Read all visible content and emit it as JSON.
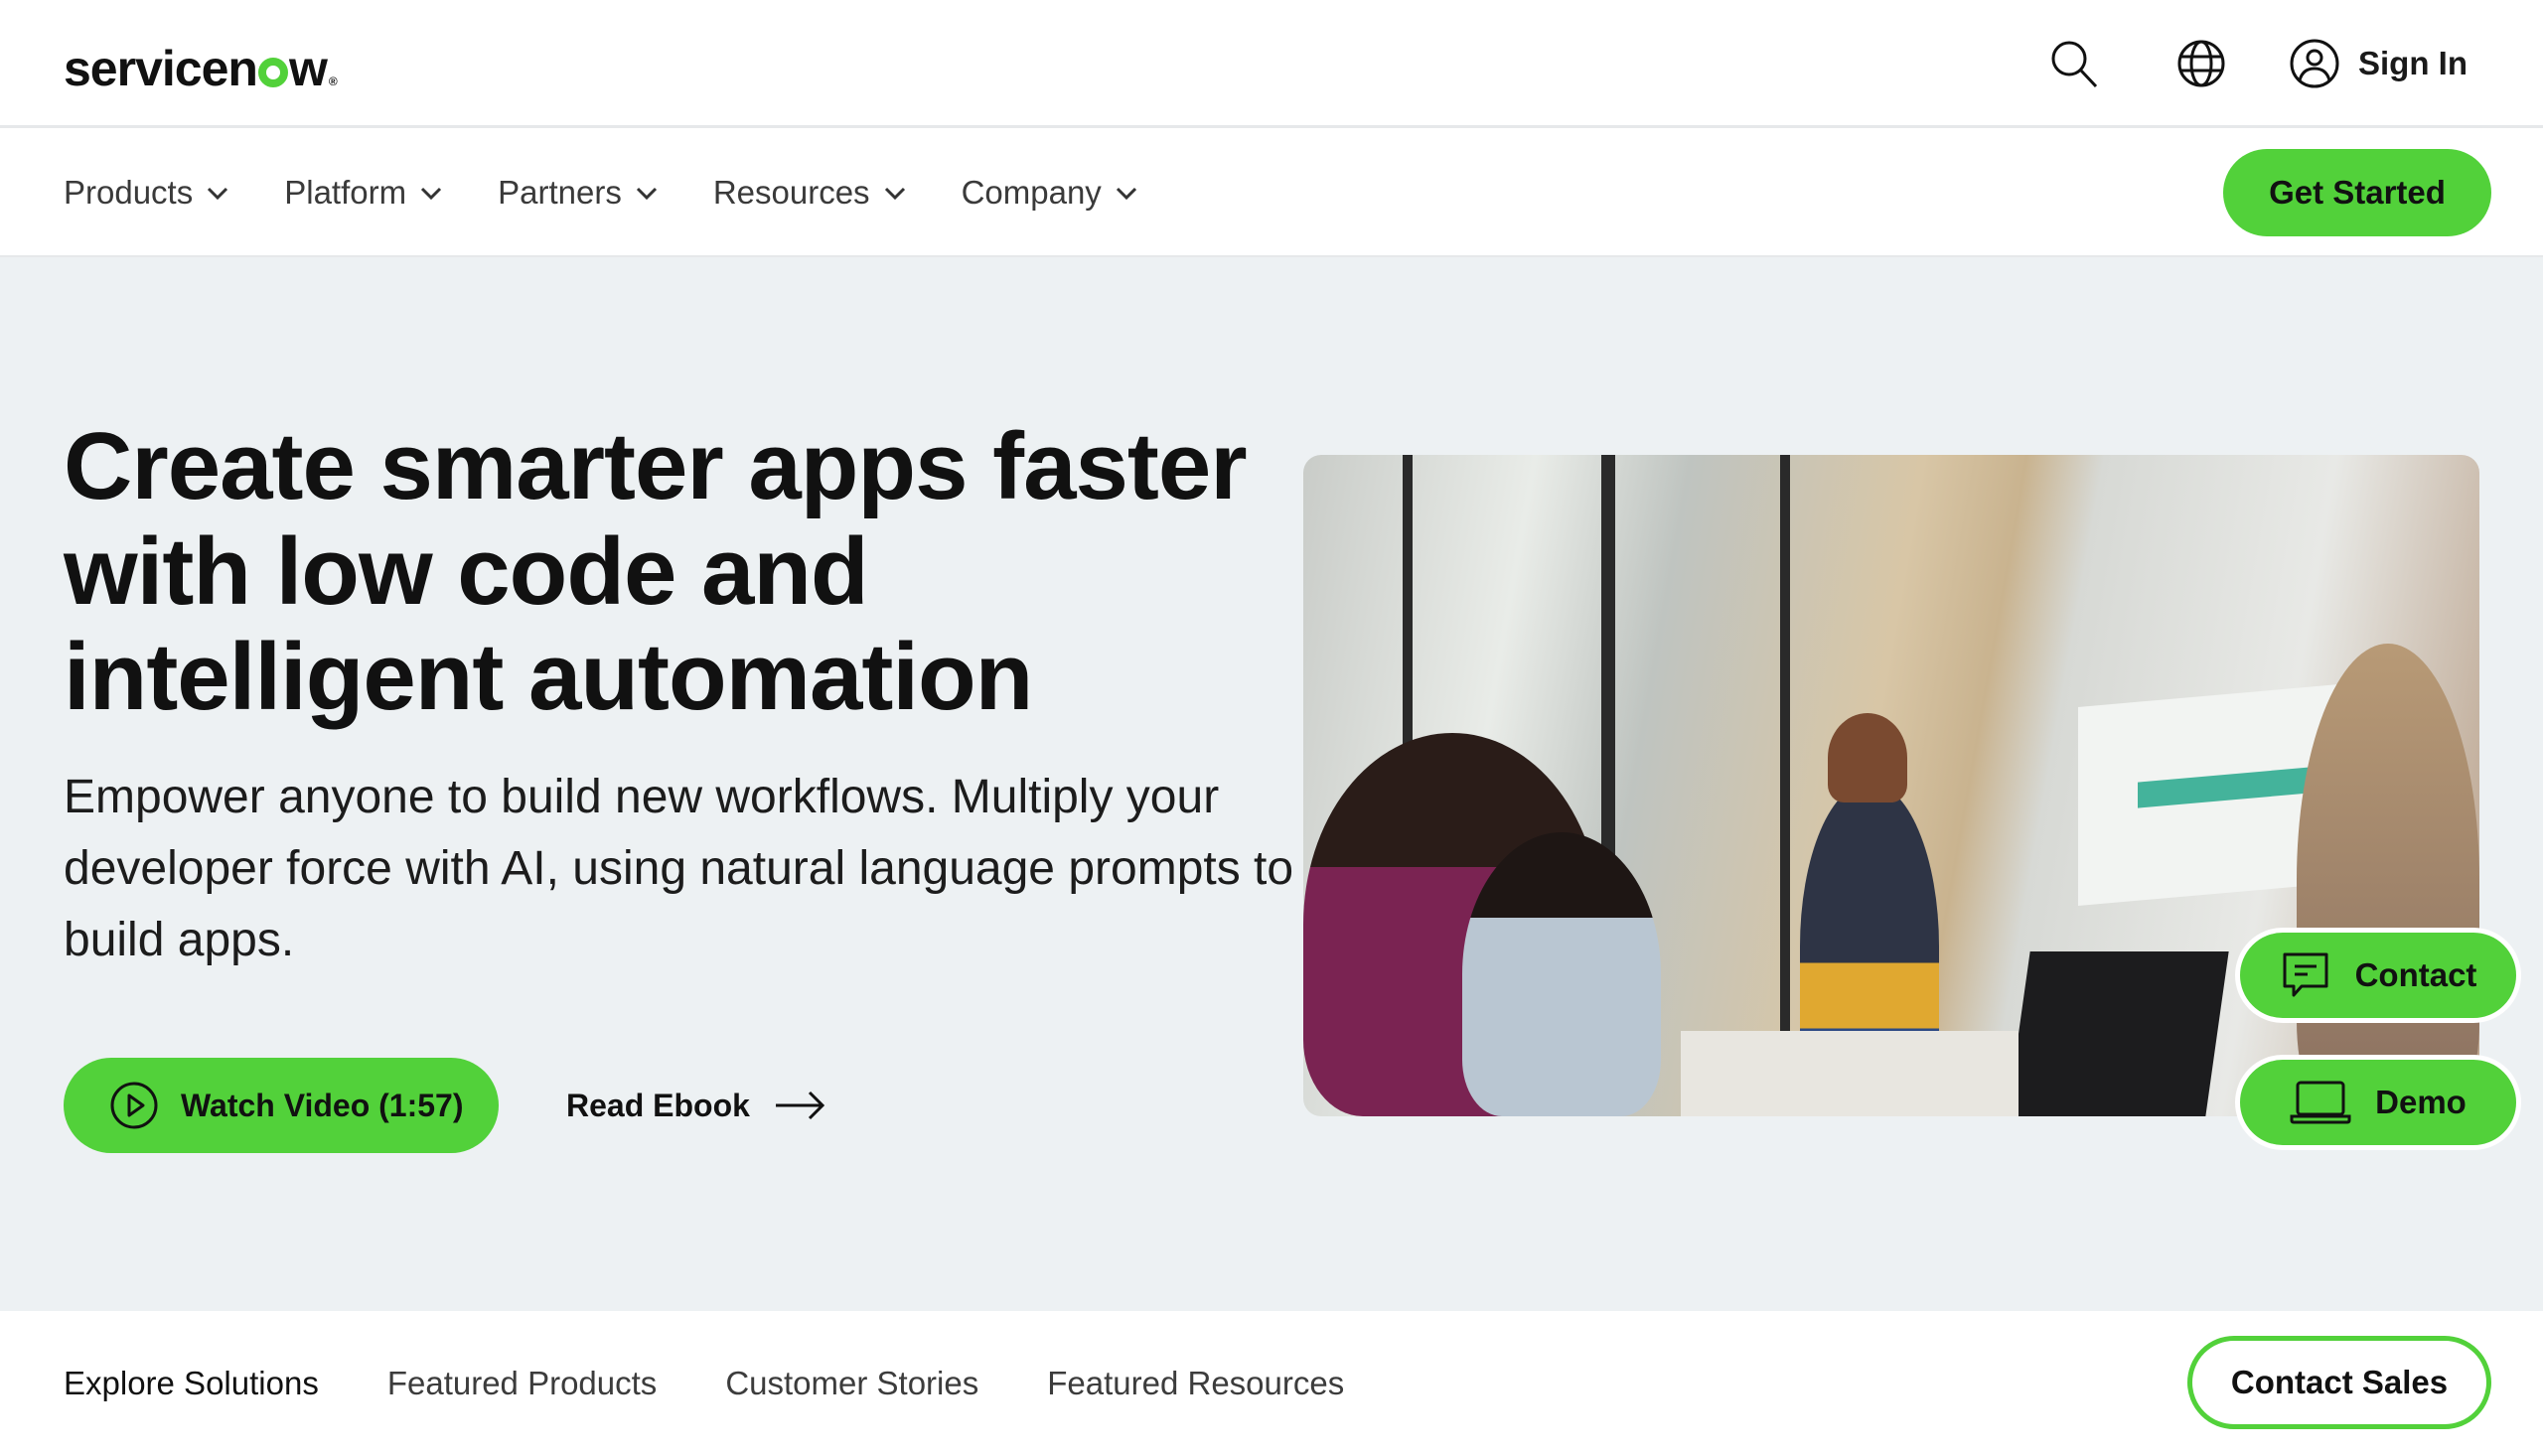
{
  "brand": {
    "logo_text_before": "servicen",
    "logo_text_after": "w",
    "logo_registered": "®",
    "accent_color": "#52d13a"
  },
  "topbar": {
    "icons": [
      "search-icon",
      "globe-icon",
      "user-circle-icon"
    ],
    "sign_in_label": "Sign In"
  },
  "nav": {
    "items": [
      {
        "label": "Products"
      },
      {
        "label": "Platform"
      },
      {
        "label": "Partners"
      },
      {
        "label": "Resources"
      },
      {
        "label": "Company"
      }
    ],
    "cta_label": "Get Started"
  },
  "hero": {
    "title": "Create smarter apps faster with low code and intelligent automation",
    "description": "Empower anyone to build new workflows. Multiply your developer force with AI, using natural language prompts to build apps.",
    "watch_video_label": "Watch Video (1:57)",
    "read_ebook_label": "Read Ebook",
    "image_alt": "Team meeting with presenter in front of a dashboard screen"
  },
  "floating": {
    "contact_label": "Contact",
    "demo_label": "Demo"
  },
  "subnav": {
    "items": [
      {
        "label": "Explore Solutions"
      },
      {
        "label": "Featured Products"
      },
      {
        "label": "Customer Stories"
      },
      {
        "label": "Featured Resources"
      }
    ],
    "contact_sales_label": "Contact Sales"
  }
}
